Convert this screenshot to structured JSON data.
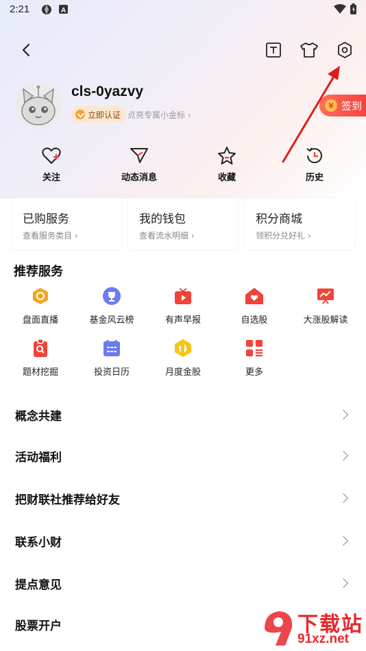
{
  "status_bar": {
    "time": "2:21"
  },
  "profile": {
    "username": "cls-0yazvy",
    "verify_label": "立即认证",
    "gold_hint": "点亮专属小金标",
    "checkin_label": "签到",
    "coin_symbol": "¥"
  },
  "quick_actions": [
    {
      "label": "关注",
      "icon": "heart-plus-icon"
    },
    {
      "label": "动态消息",
      "icon": "paper-plane-icon"
    },
    {
      "label": "收藏",
      "icon": "star-icon"
    },
    {
      "label": "历史",
      "icon": "history-clock-icon"
    }
  ],
  "cards": [
    {
      "title": "已购服务",
      "sub": "查看服务类目"
    },
    {
      "title": "我的钱包",
      "sub": "查看流水明细"
    },
    {
      "title": "积分商城",
      "sub": "领积分兑好礼"
    }
  ],
  "recommended": {
    "title": "推荐服务",
    "items": [
      {
        "label": "盘面直播",
        "icon": "live-board-icon",
        "color": "#f5a623"
      },
      {
        "label": "基金风云榜",
        "icon": "trophy-icon",
        "color": "#6b7bf0"
      },
      {
        "label": "有声早报",
        "icon": "tv-play-icon",
        "color": "#f0433a"
      },
      {
        "label": "自选股",
        "icon": "heart-house-icon",
        "color": "#f0433a"
      },
      {
        "label": "大涨股解读",
        "icon": "trend-screen-icon",
        "color": "#f0433a"
      },
      {
        "label": "题材挖掘",
        "icon": "clipboard-search-icon",
        "color": "#f0433a"
      },
      {
        "label": "投资日历",
        "icon": "calendar-icon",
        "color": "#6b7bf0"
      },
      {
        "label": "月度金股",
        "icon": "gold-hexagon-icon",
        "color": "#f5c518"
      },
      {
        "label": "更多",
        "icon": "grid-more-icon",
        "color": "#f0433a"
      }
    ]
  },
  "menu": [
    {
      "label": "概念共建"
    },
    {
      "label": "活动福利"
    },
    {
      "label": "把财联社推荐给好友"
    },
    {
      "label": "联系小财"
    },
    {
      "label": "提点意见"
    },
    {
      "label": "股票开户"
    }
  ],
  "watermark": {
    "top": "下载站",
    "bottom": "91xz.net"
  },
  "colors": {
    "accent_red": "#f0433a",
    "annotation_red": "#e01b1b",
    "badge_bg": "#fbe8cf"
  }
}
